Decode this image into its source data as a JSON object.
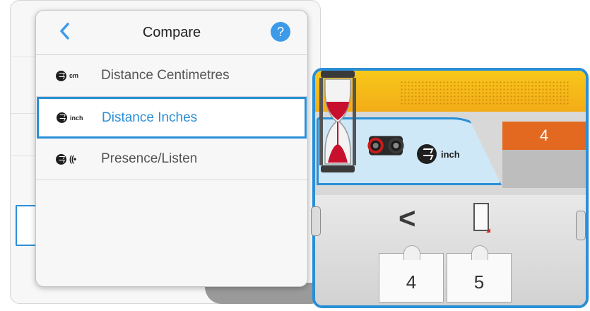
{
  "popover": {
    "title": "Compare",
    "back_icon": "chevron-left-icon",
    "help_label": "?",
    "items": [
      {
        "label": "Distance Centimetres",
        "unit": "cm",
        "icon": "ultrasonic-sensor-icon",
        "selected": false
      },
      {
        "label": "Distance Inches",
        "unit": "inch",
        "icon": "ultrasonic-sensor-icon",
        "selected": true
      },
      {
        "label": "Presence/Listen",
        "unit": "((•",
        "icon": "ultrasonic-sensor-icon",
        "selected": false
      }
    ]
  },
  "block": {
    "port": "4",
    "mode_unit": "inch",
    "compare_operator": "<",
    "inputs": [
      "4",
      "5"
    ]
  },
  "colors": {
    "accent": "#2a8fd6",
    "block_top": "#f2a516",
    "port": "#e2691f",
    "help": "#3d9ae8"
  }
}
